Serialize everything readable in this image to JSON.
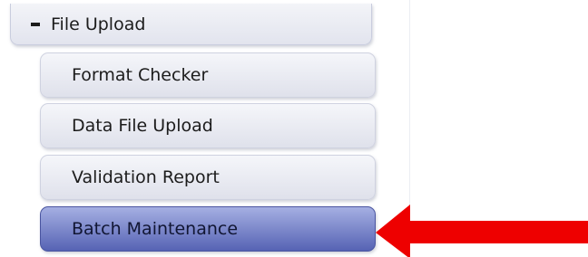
{
  "menu": {
    "section_label": "File Upload",
    "collapse_icon": "minus-icon",
    "items": [
      {
        "label": "Format Checker",
        "active": false
      },
      {
        "label": "Data File Upload",
        "active": false
      },
      {
        "label": "Validation Report",
        "active": false
      },
      {
        "label": "Batch Maintenance",
        "active": true
      }
    ]
  },
  "annotation": {
    "icon": "arrow-left-icon",
    "color": "#ee0000"
  },
  "colors": {
    "active_item": "#6b76c2",
    "item_background": "#e4e6ef"
  }
}
